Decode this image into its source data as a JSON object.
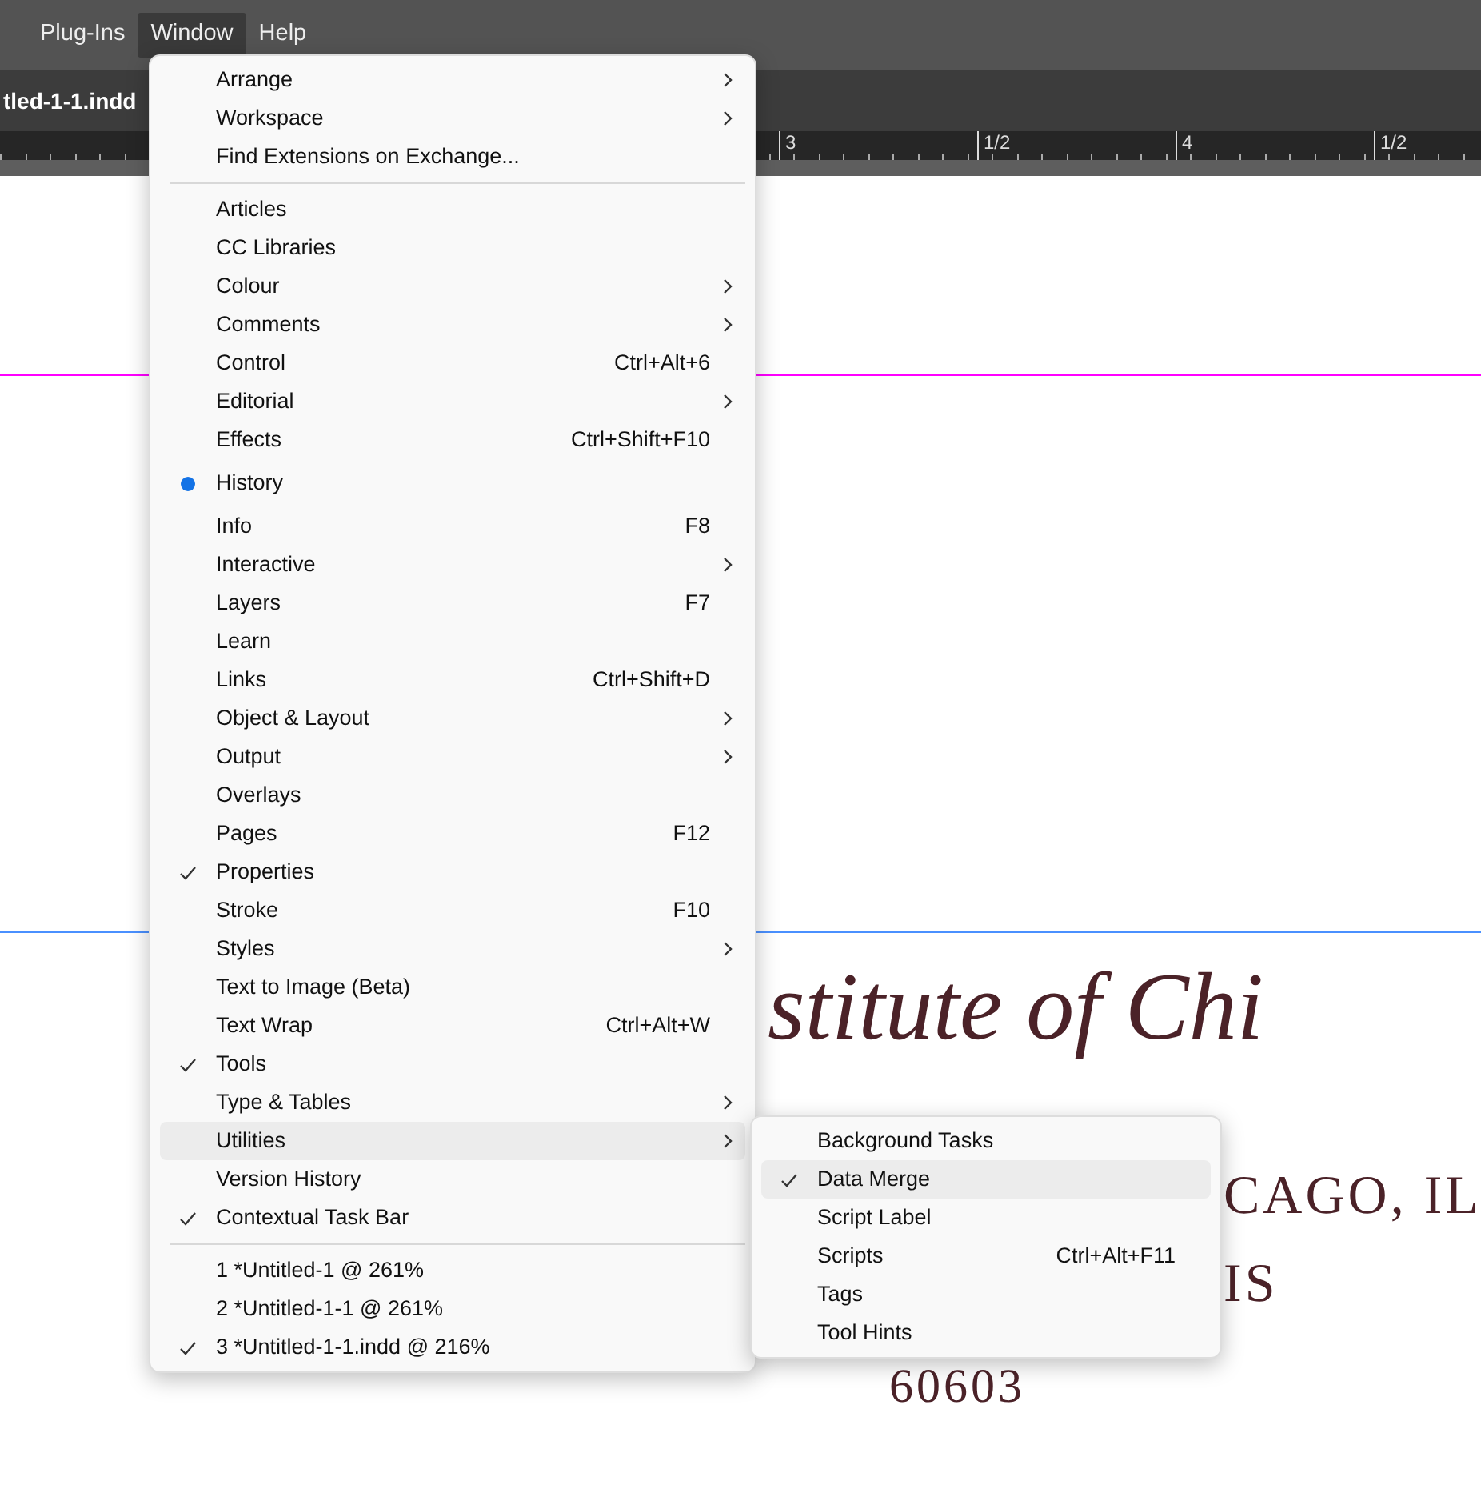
{
  "menubar": [
    {
      "label": "Plug-Ins",
      "selected": false
    },
    {
      "label": "Window",
      "selected": true
    },
    {
      "label": "Help",
      "selected": false
    }
  ],
  "document_tab": {
    "label": "tled-1-1.indd"
  },
  "ruler": {
    "labels": [
      "3",
      "1/2",
      "4",
      "1/2"
    ]
  },
  "canvas": {
    "script_line": "stitute of Chi",
    "address_line": "CAGO, IL",
    "line_3": "IS",
    "zip": "60603"
  },
  "window_menu": {
    "sections": [
      [
        {
          "label": "Arrange",
          "submenu": true,
          "checked": false,
          "kind": "item",
          "selected": false
        },
        {
          "label": "Workspace",
          "submenu": true,
          "checked": false,
          "kind": "item",
          "selected": false
        },
        {
          "label": "Find Extensions on Exchange...",
          "submenu": false,
          "checked": false,
          "kind": "item",
          "selected": false
        }
      ],
      [
        {
          "label": "Articles",
          "submenu": false,
          "checked": false,
          "kind": "item",
          "selected": false
        },
        {
          "label": "CC Libraries",
          "submenu": false,
          "checked": false,
          "kind": "item",
          "selected": false
        },
        {
          "label": "Colour",
          "submenu": true,
          "checked": false,
          "kind": "item",
          "selected": false
        },
        {
          "label": "Comments",
          "submenu": true,
          "checked": false,
          "kind": "item",
          "selected": false
        },
        {
          "label": "Control",
          "shortcut": "Ctrl+Alt+6",
          "submenu": false,
          "checked": false,
          "kind": "item",
          "selected": false
        },
        {
          "label": "Editorial",
          "submenu": true,
          "checked": false,
          "kind": "item",
          "selected": false
        },
        {
          "label": "Effects",
          "shortcut": "Ctrl+Shift+F10",
          "submenu": false,
          "checked": false,
          "kind": "item",
          "selected": false
        },
        {
          "label": "History",
          "submenu": false,
          "checked": true,
          "kind": "radio",
          "selected": false
        },
        {
          "label": "Info",
          "shortcut": "F8",
          "submenu": false,
          "checked": false,
          "kind": "item",
          "selected": false
        },
        {
          "label": "Interactive",
          "submenu": true,
          "checked": false,
          "kind": "item",
          "selected": false
        },
        {
          "label": "Layers",
          "shortcut": "F7",
          "submenu": false,
          "checked": false,
          "kind": "item",
          "selected": false
        },
        {
          "label": "Learn",
          "submenu": false,
          "checked": false,
          "kind": "item",
          "selected": false
        },
        {
          "label": "Links",
          "shortcut": "Ctrl+Shift+D",
          "submenu": false,
          "checked": false,
          "kind": "item",
          "selected": false
        },
        {
          "label": "Object & Layout",
          "submenu": true,
          "checked": false,
          "kind": "item",
          "selected": false
        },
        {
          "label": "Output",
          "submenu": true,
          "checked": false,
          "kind": "item",
          "selected": false
        },
        {
          "label": "Overlays",
          "submenu": false,
          "checked": false,
          "kind": "item",
          "selected": false
        },
        {
          "label": "Pages",
          "shortcut": "F12",
          "submenu": false,
          "checked": false,
          "kind": "item",
          "selected": false
        },
        {
          "label": "Properties",
          "submenu": false,
          "checked": true,
          "kind": "item",
          "selected": false
        },
        {
          "label": "Stroke",
          "shortcut": "F10",
          "submenu": false,
          "checked": false,
          "kind": "item",
          "selected": false
        },
        {
          "label": "Styles",
          "submenu": true,
          "checked": false,
          "kind": "item",
          "selected": false
        },
        {
          "label": "Text to Image (Beta)",
          "submenu": false,
          "checked": false,
          "kind": "item",
          "selected": false
        },
        {
          "label": "Text Wrap",
          "shortcut": "Ctrl+Alt+W",
          "submenu": false,
          "checked": false,
          "kind": "item",
          "selected": false
        },
        {
          "label": "Tools",
          "submenu": false,
          "checked": true,
          "kind": "item",
          "selected": false
        },
        {
          "label": "Type & Tables",
          "submenu": true,
          "checked": false,
          "kind": "item",
          "selected": false
        },
        {
          "label": "Utilities",
          "submenu": true,
          "checked": false,
          "kind": "item",
          "selected": true
        },
        {
          "label": "Version History",
          "submenu": false,
          "checked": false,
          "kind": "item",
          "selected": false
        },
        {
          "label": "Contextual Task Bar",
          "submenu": false,
          "checked": true,
          "kind": "item",
          "selected": false
        }
      ],
      [
        {
          "label": "1 *Untitled-1 @ 261%",
          "submenu": false,
          "checked": false,
          "kind": "item",
          "selected": false
        },
        {
          "label": "2 *Untitled-1-1 @ 261%",
          "submenu": false,
          "checked": false,
          "kind": "item",
          "selected": false
        },
        {
          "label": "3 *Untitled-1-1.indd @ 216%",
          "submenu": false,
          "checked": true,
          "kind": "item",
          "selected": false
        }
      ]
    ]
  },
  "utilities_submenu": {
    "items": [
      {
        "label": "Background Tasks",
        "checked": false,
        "selected": false
      },
      {
        "label": "Data Merge",
        "checked": true,
        "selected": true
      },
      {
        "label": "Script Label",
        "checked": false,
        "selected": false
      },
      {
        "label": "Scripts",
        "shortcut": "Ctrl+Alt+F11",
        "checked": false,
        "selected": false
      },
      {
        "label": "Tags",
        "checked": false,
        "selected": false
      },
      {
        "label": "Tool Hints",
        "checked": false,
        "selected": false
      }
    ]
  }
}
